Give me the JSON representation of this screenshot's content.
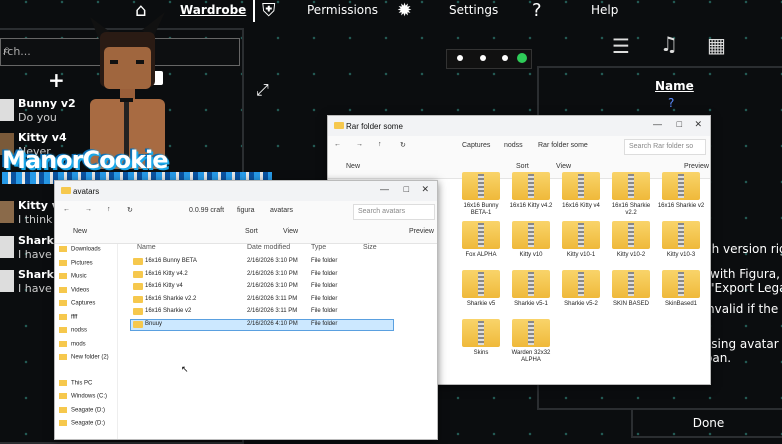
{
  "topbar": {
    "wardrobe": "Wardrobe",
    "permissions": "Permissions",
    "settings": "Settings",
    "help": "Help"
  },
  "left": {
    "search_placeholder": "rch...",
    "friends": [
      {
        "name": "Bunny v2",
        "status": "Do you"
      },
      {
        "name": "Kitty v4",
        "status": "Never"
      },
      {
        "name": "Kitty v4",
        "status": "I think t"
      },
      {
        "name": "Sharkie",
        "status": "I have t"
      },
      {
        "name": "Sharkie",
        "status": "I have t"
      }
    ]
  },
  "banner": {
    "text": "ManorCookie"
  },
  "right": {
    "name_header": "Name",
    "name_value": "?",
    "lines": [
      "ch version righ",
      "with Figura,",
      "\"Export Lega",
      "nvalid if the",
      "ssing avatar",
      "oan."
    ],
    "done": "Done"
  },
  "colors": {
    "accent_green": "#2ecc58",
    "folder": "#f6c84d",
    "selection": "#cce8ff"
  },
  "win_back": {
    "title": "Rar folder some",
    "path": [
      "Captures",
      "nodss",
      "Rar folder some"
    ],
    "search_placeholder": "Search Rar folder so",
    "new": "New",
    "sort": "Sort",
    "view": "View",
    "preview": "Preview",
    "tiles": [
      "16x16 Bunny BETA-1",
      "16x16 Kitty v4.2",
      "16x16 Kitty v4",
      "16x16 Sharkie v2.2",
      "16x16 Sharkie v2",
      "Fox ALPHA",
      "Kitty v10",
      "Kitty v10-1",
      "Kitty v10-2",
      "Kitty v10-3",
      "Sharkie v5",
      "Sharkie v5-1",
      "Sharkie v5-2",
      "SKIN BASED",
      "SkinBased1",
      "Skins",
      "Warden 32x32 ALPHA"
    ]
  },
  "win_front": {
    "title": "avatars",
    "path": [
      "0.0.99 craft",
      "figura",
      "avatars"
    ],
    "search_placeholder": "Search avatars",
    "new": "New",
    "sort": "Sort",
    "view": "View",
    "preview": "Preview",
    "columns": [
      "Name",
      "Date modified",
      "Type",
      "Size"
    ],
    "rows": [
      {
        "name": "16x16 Bunny BETA",
        "date": "2/16/2026 3:10 PM",
        "type": "File folder"
      },
      {
        "name": "16x16 Kitty v4.2",
        "date": "2/16/2026 3:10 PM",
        "type": "File folder"
      },
      {
        "name": "16x16 Kitty v4",
        "date": "2/16/2026 3:10 PM",
        "type": "File folder"
      },
      {
        "name": "16x16 Sharkie v2.2",
        "date": "2/16/2026 3:11 PM",
        "type": "File folder"
      },
      {
        "name": "16x16 Sharkie v2",
        "date": "2/16/2026 3:11 PM",
        "type": "File folder"
      },
      {
        "name": "Bnuuy",
        "date": "2/16/2026 4:10 PM",
        "type": "File folder"
      }
    ],
    "nav": [
      "Downloads",
      "Pictures",
      "Music",
      "Videos",
      "Captures",
      "ffff",
      "nodss",
      "mods",
      "New folder (2)",
      "This PC",
      "Windows (C:)",
      "Seagate (D:)",
      "Seagate (D:)"
    ]
  }
}
